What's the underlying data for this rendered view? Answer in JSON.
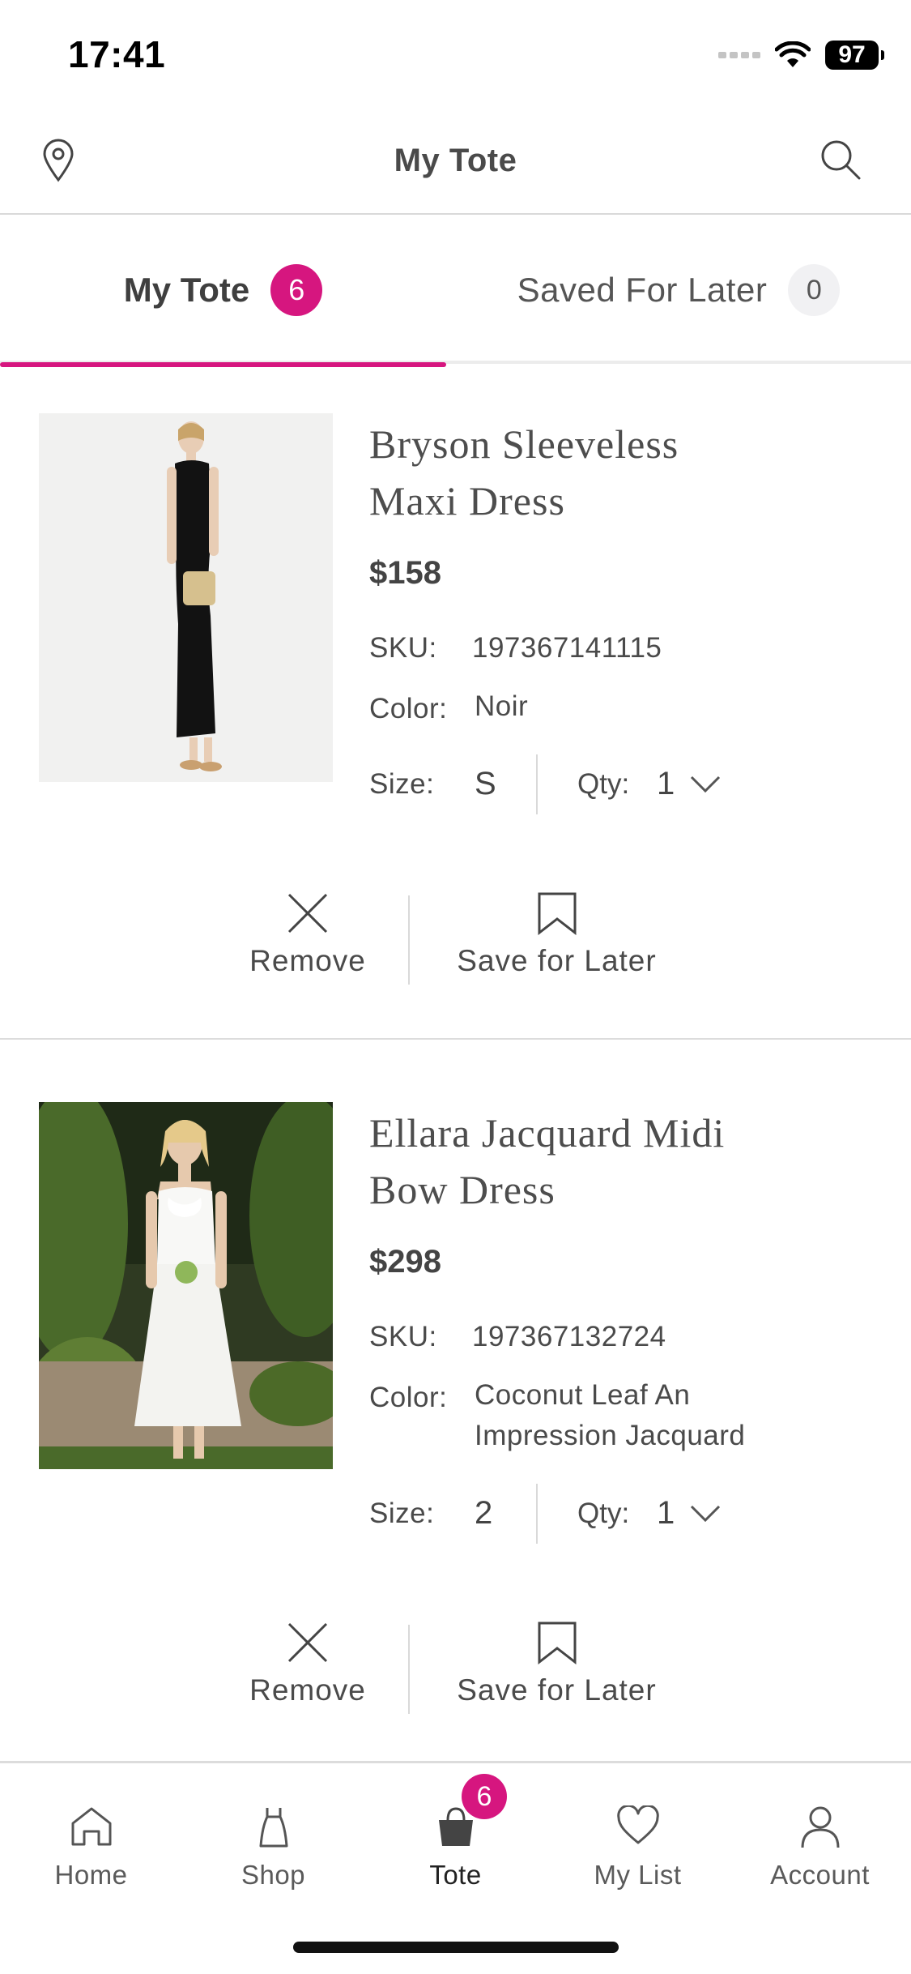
{
  "status_bar": {
    "time": "17:41",
    "battery": "97"
  },
  "header": {
    "title": "My Tote"
  },
  "tabs": [
    {
      "label": "My Tote",
      "count": "6",
      "active": true
    },
    {
      "label": "Saved For Later",
      "count": "0",
      "active": false
    }
  ],
  "products": [
    {
      "name_line1": "Bryson Sleeveless",
      "name_line2": "Maxi Dress",
      "price": "$158",
      "sku_label": "SKU:",
      "sku": "197367141115",
      "color_label": "Color:",
      "color": "Noir",
      "size_label": "Size:",
      "size": "S",
      "qty_label": "Qty:",
      "qty": "1",
      "remove_label": "Remove",
      "save_label": "Save for Later"
    },
    {
      "name_line1": "Ellara Jacquard Midi",
      "name_line2": "Bow Dress",
      "price": "$298",
      "sku_label": "SKU:",
      "sku": "197367132724",
      "color_label": "Color:",
      "color_line1": "Coconut Leaf An",
      "color_line2": "Impression Jacquard",
      "size_label": "Size:",
      "size": "2",
      "qty_label": "Qty:",
      "qty": "1",
      "remove_label": "Remove",
      "save_label": "Save for Later"
    }
  ],
  "bottom_nav": [
    {
      "label": "Home",
      "icon": "home-icon"
    },
    {
      "label": "Shop",
      "icon": "dress-icon"
    },
    {
      "label": "Tote",
      "icon": "tote-bag-icon",
      "badge": "6",
      "active": true
    },
    {
      "label": "My List",
      "icon": "heart-icon"
    },
    {
      "label": "Account",
      "icon": "user-icon"
    }
  ],
  "colors": {
    "accent": "#d6167f",
    "text": "#3d3d3d",
    "divider": "#dcdcdc"
  }
}
